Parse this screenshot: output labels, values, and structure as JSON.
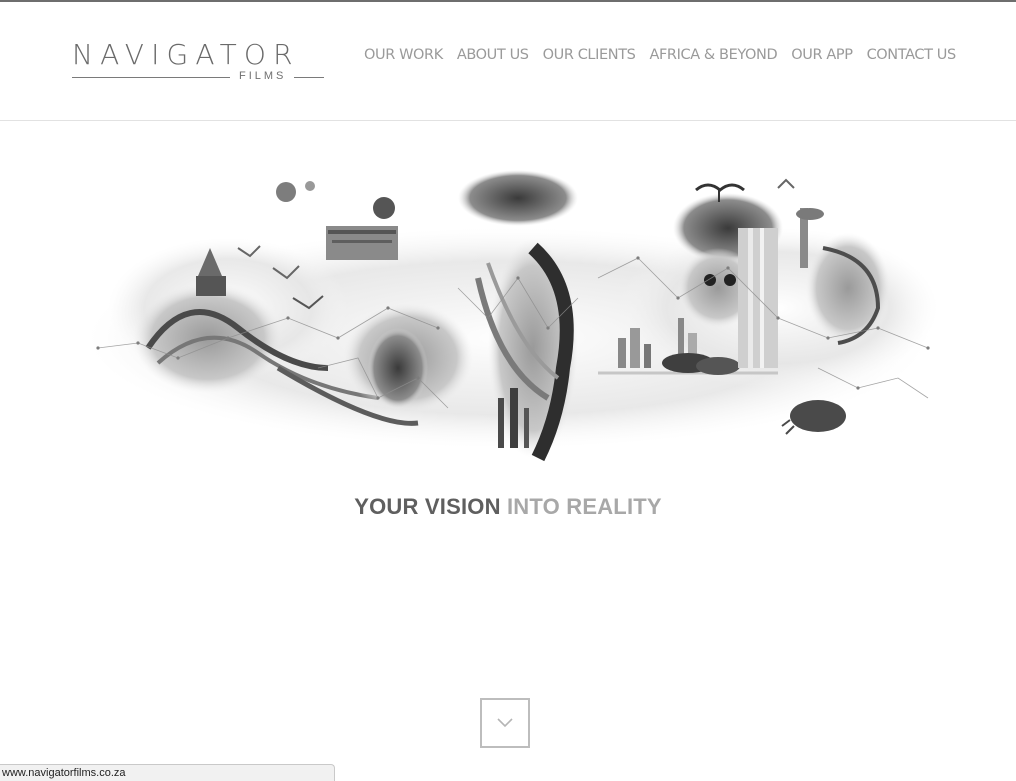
{
  "logo": {
    "word": "NAVIGATOR",
    "sub": "FILMS"
  },
  "nav": {
    "items": [
      {
        "label": "OUR WORK"
      },
      {
        "label": "ABOUT US"
      },
      {
        "label": "OUR CLIENTS"
      },
      {
        "label": "AFRICA & BEYOND"
      },
      {
        "label": "OUR APP"
      },
      {
        "label": "CONTACT US"
      }
    ]
  },
  "hero": {
    "tagline_dark": "YOUR VISION",
    "tagline_light": "INTO REALITY"
  },
  "scroll": {
    "icon": "chevron-down-icon"
  },
  "status": {
    "url": "www.navigatorfilms.co.za"
  },
  "colors": {
    "nav_text": "#9a9a9a",
    "tagline_dark": "#5f5f5f",
    "tagline_light": "#a8a8a8"
  }
}
